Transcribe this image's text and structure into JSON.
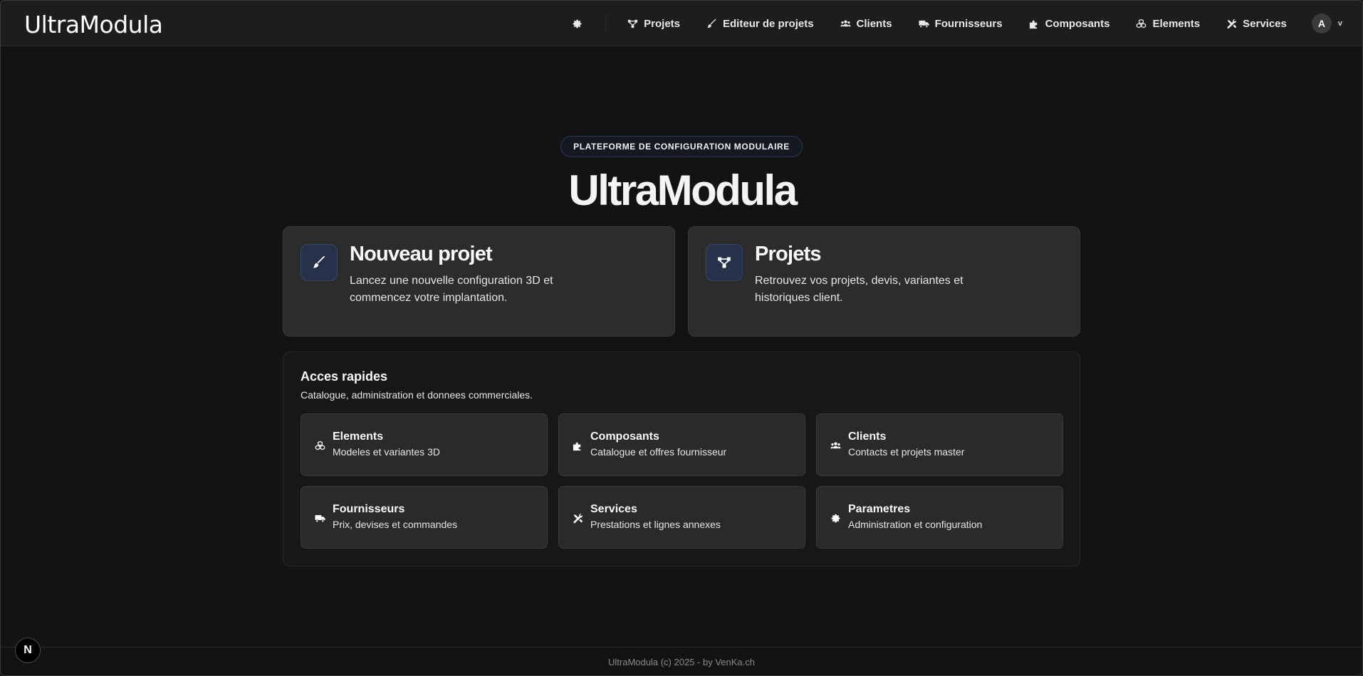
{
  "header": {
    "brand": "UltraModula",
    "settings_icon": "gear-icon",
    "nav": [
      {
        "label": "Projets",
        "icon": "diagram-icon"
      },
      {
        "label": "Editeur de projets",
        "icon": "brush-icon"
      },
      {
        "label": "Clients",
        "icon": "users-icon"
      },
      {
        "label": "Fournisseurs",
        "icon": "truck-icon"
      },
      {
        "label": "Composants",
        "icon": "puzzle-icon"
      },
      {
        "label": "Elements",
        "icon": "cubes-icon"
      },
      {
        "label": "Services",
        "icon": "tools-icon"
      }
    ],
    "avatar_initial": "A",
    "avatar_caret": "v"
  },
  "hero": {
    "badge": "PLATEFORME DE CONFIGURATION MODULAIRE",
    "title": "UltraModula"
  },
  "cards": [
    {
      "title": "Nouveau projet",
      "description": "Lancez une nouvelle configuration 3D et commencez votre implantation.",
      "icon": "brush-icon"
    },
    {
      "title": "Projets",
      "description": "Retrouvez vos projets, devis, variantes et historiques client.",
      "icon": "diagram-icon"
    }
  ],
  "quick_access": {
    "title": "Acces rapides",
    "subtitle": "Catalogue, administration et donnees commerciales.",
    "items": [
      {
        "title": "Elements",
        "description": "Modeles et variantes 3D",
        "icon": "cubes-icon"
      },
      {
        "title": "Composants",
        "description": "Catalogue et offres fournisseur",
        "icon": "puzzle-icon"
      },
      {
        "title": "Clients",
        "description": "Contacts et projets master",
        "icon": "users-icon"
      },
      {
        "title": "Fournisseurs",
        "description": "Prix, devises et commandes",
        "icon": "truck-icon"
      },
      {
        "title": "Services",
        "description": "Prestations et lignes annexes",
        "icon": "tools-icon"
      },
      {
        "title": "Parametres",
        "description": "Administration et configuration",
        "icon": "gear-icon"
      }
    ]
  },
  "footer": {
    "text": "UltraModula (c) 2025 - by VenKa.ch",
    "dev_badge": "N"
  },
  "colors": {
    "background": "#131313",
    "topbar": "#1d1d1d",
    "card": "#2c2c2c",
    "icon_tile": "#27324a",
    "badge_border": "#2b3a5c"
  }
}
